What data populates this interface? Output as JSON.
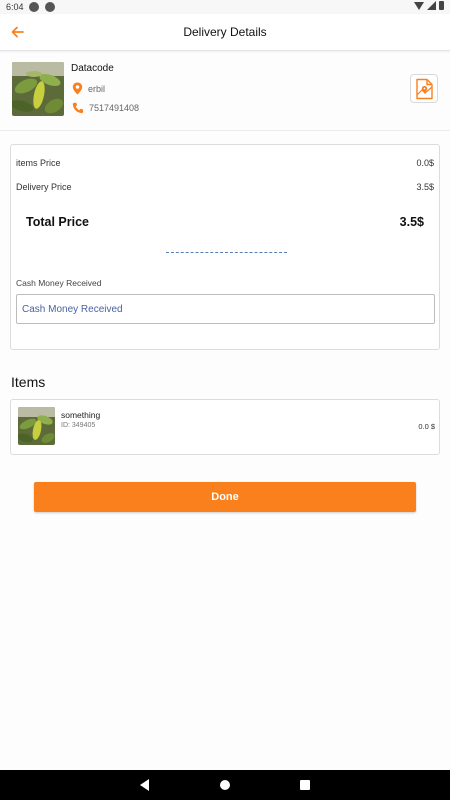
{
  "status_bar": {
    "time": "6:04"
  },
  "header": {
    "title": "Delivery Details",
    "back_icon": "arrow-left-icon"
  },
  "customer": {
    "name": "Datacode",
    "location": "erbil",
    "phone": "7517491408",
    "location_icon": "location-pin-icon",
    "phone_icon": "phone-icon",
    "map_icon": "map-document-icon"
  },
  "summary": {
    "items_price_label": "items Price",
    "items_price_value": "0.0$",
    "delivery_price_label": "Delivery Price",
    "delivery_price_value": "3.5$",
    "total_label": "Total Price",
    "total_value": "3.5$",
    "cash_label": "Cash Money Received",
    "cash_placeholder": "Cash Money Received",
    "cash_value": ""
  },
  "items_section": {
    "heading": "Items",
    "items": [
      {
        "name": "something",
        "id": "ID: 349405",
        "price": "0.0 $"
      }
    ]
  },
  "actions": {
    "done_label": "Done"
  },
  "colors": {
    "accent": "#f9801d",
    "link_blue": "#4a62a3"
  }
}
